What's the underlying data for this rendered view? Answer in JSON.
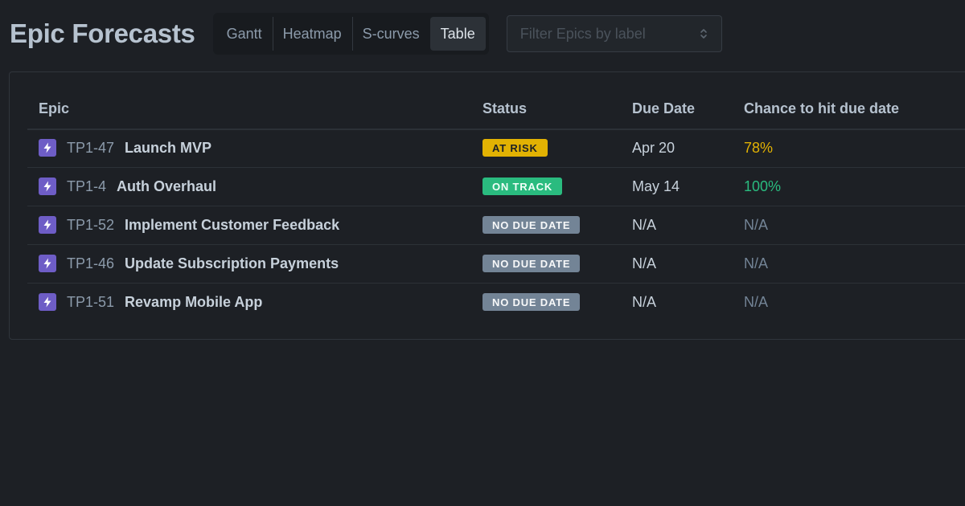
{
  "header": {
    "title": "Epic Forecasts",
    "tabs": [
      "Gantt",
      "Heatmap",
      "S-curves",
      "Table"
    ],
    "active_tab": "Table",
    "filter_placeholder": "Filter Epics by label"
  },
  "table": {
    "columns": [
      "Epic",
      "Status",
      "Due Date",
      "Chance to hit due date"
    ],
    "rows": [
      {
        "key": "TP1-47",
        "name": "Launch MVP",
        "status": "AT RISK",
        "status_kind": "risk",
        "due": "Apr 20",
        "chance": "78%",
        "chance_color": "#e2b203"
      },
      {
        "key": "TP1-4",
        "name": "Auth Overhaul",
        "status": "ON TRACK",
        "status_kind": "track",
        "due": "May 14",
        "chance": "100%",
        "chance_color": "#2abb7f"
      },
      {
        "key": "TP1-52",
        "name": "Implement Customer Feedback",
        "status": "NO DUE DATE",
        "status_kind": "none",
        "due": "N/A",
        "chance": "N/A",
        "chance_color": "#738496"
      },
      {
        "key": "TP1-46",
        "name": "Update Subscription Payments",
        "status": "NO DUE DATE",
        "status_kind": "none",
        "due": "N/A",
        "chance": "N/A",
        "chance_color": "#738496"
      },
      {
        "key": "TP1-51",
        "name": "Revamp Mobile App",
        "status": "NO DUE DATE",
        "status_kind": "none",
        "due": "N/A",
        "chance": "N/A",
        "chance_color": "#738496"
      }
    ],
    "epic_icon": "lightning-bolt-icon"
  }
}
